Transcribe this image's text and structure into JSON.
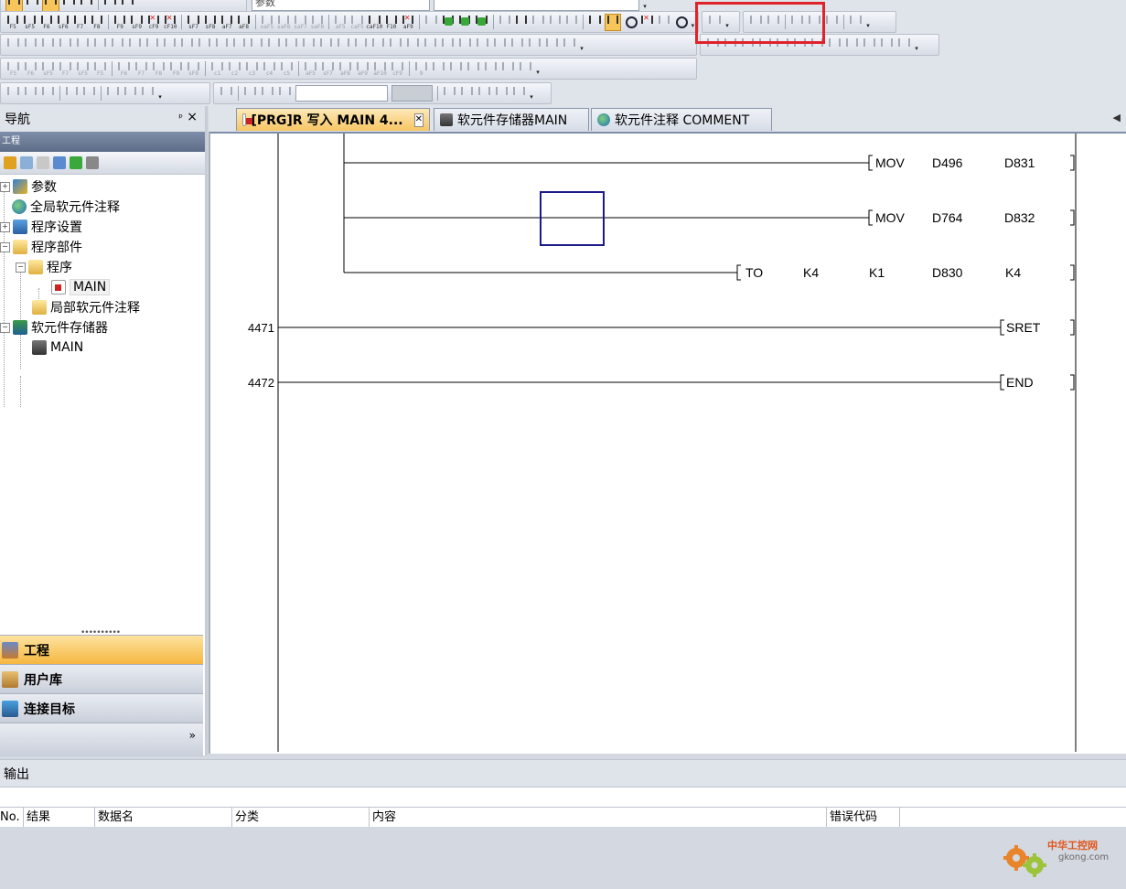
{
  "toolbar": {
    "top_combo_value": "参数",
    "row1_keys": [
      "F5",
      "sF5",
      "F6",
      "sF6",
      "F7",
      "F8",
      "F9",
      "sF9",
      "cF9",
      "cF10",
      "sF7",
      "sF8",
      "aF7",
      "aF8",
      "saF5",
      "saF6",
      "saF7",
      "saF8",
      "aF5",
      "caF5",
      "caF10",
      "F10",
      "aF9"
    ],
    "row3_keys": [
      "F5",
      "F6",
      "sF5",
      "F7",
      "sF5",
      "F5",
      "F6",
      "F7",
      "F8",
      "F9",
      "sF9",
      "c1",
      "c2",
      "c3",
      "c4",
      "c5",
      "aF5",
      "sF7",
      "aF8",
      "aF9",
      "aF10",
      "cF9",
      "9"
    ],
    "highlight_group_note": ""
  },
  "navigation": {
    "title": "导航",
    "pin": "ᵖ",
    "close": "×",
    "project_header": "工程",
    "tree": [
      {
        "label": "参数",
        "icon": "parameter-icon"
      },
      {
        "label": "全局软元件注释",
        "icon": "globe-icon"
      },
      {
        "label": "程序设置",
        "icon": "program-settings-icon"
      },
      {
        "label": "程序部件",
        "icon": "program-parts-icon"
      },
      {
        "label": "程序",
        "icon": "folder-icon"
      },
      {
        "label": "MAIN",
        "icon": "program-file-icon"
      },
      {
        "label": "局部软元件注释",
        "icon": "folder-icon"
      },
      {
        "label": "软元件存储器",
        "icon": "device-memory-icon"
      },
      {
        "label": "MAIN",
        "icon": "memory-file-icon"
      }
    ],
    "panels": {
      "project": "工程",
      "user_library": "用户库",
      "connection": "连接目标",
      "more": "»"
    }
  },
  "tabs": [
    {
      "label": "[PRG]R 写入 MAIN 4...",
      "active": true
    },
    {
      "label": "软元件存储器MAIN",
      "active": false
    },
    {
      "label": "软元件注释 COMMENT",
      "active": false
    }
  ],
  "ladder": {
    "rows": [
      {
        "step": "",
        "instr": [
          "MOV",
          "D496",
          "D831"
        ]
      },
      {
        "step": "",
        "instr": [
          "MOV",
          "D764",
          "D832"
        ]
      },
      {
        "step": "",
        "instr": [
          "TO",
          "K4",
          "K1",
          "D830",
          "K4"
        ]
      },
      {
        "step": "4471",
        "instr": [
          "SRET"
        ]
      },
      {
        "step": "4472",
        "instr": [
          "END"
        ]
      }
    ]
  },
  "output": {
    "title": "输出",
    "columns": [
      "No.",
      "结果",
      "数据名",
      "分类",
      "内容",
      "错误代码"
    ]
  },
  "watermark": {
    "cn": "中华工控网",
    "en": "gkong.com"
  },
  "colors": {
    "highlight_box": "#e0232a",
    "active_tab": "#f7c663",
    "cursor_box": "#1a1a8a"
  }
}
